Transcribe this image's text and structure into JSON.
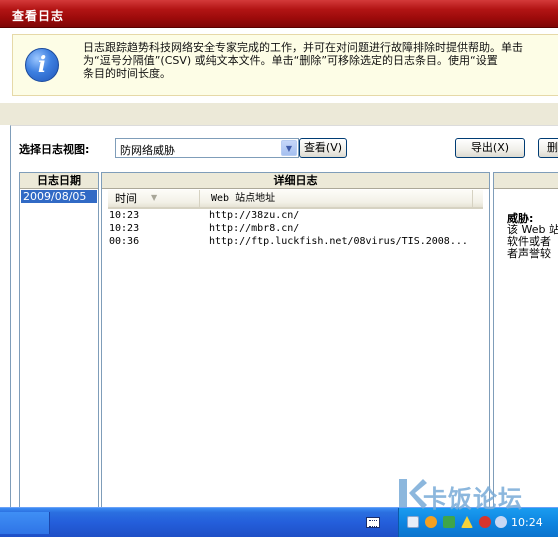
{
  "window": {
    "title": "查看日志"
  },
  "banner": {
    "line1": "日志跟踪趋势科技网络安全专家完成的工作，并可在对问题进行故障排除时提供帮助。单击",
    "line2": "为“逗号分隔值”(CSV) 或纯文本文件。单击“删除”可移除选定的日志条目。使用“设置",
    "line3": "条目的时间长度。",
    "icon": "info-icon"
  },
  "toolbar": {
    "view_label": "选择日志视图:",
    "selected_view": "防网络威胁",
    "view_button": "查看(V)",
    "export_button": "导出(X)",
    "delete_button": "删"
  },
  "date_panel": {
    "header": "日志日期",
    "items": [
      "2009/08/05"
    ]
  },
  "detail_panel": {
    "header": "详细日志",
    "columns": {
      "time": "时间",
      "url": "Web 站点地址"
    },
    "rows": [
      {
        "time": "10:23",
        "url": "http://38zu.cn/"
      },
      {
        "time": "10:23",
        "url": "http://mbr8.cn/"
      },
      {
        "time": "00:36",
        "url": "http://ftp.luckfish.net/08virus/TIS.2008..."
      }
    ]
  },
  "threat_panel": {
    "title": "威胁:",
    "lines": [
      "该 Web 站",
      "软件或者",
      "者声誉较"
    ]
  },
  "taskbar": {
    "clock": "10:24"
  },
  "watermark": {
    "text": "卡饭论坛"
  }
}
